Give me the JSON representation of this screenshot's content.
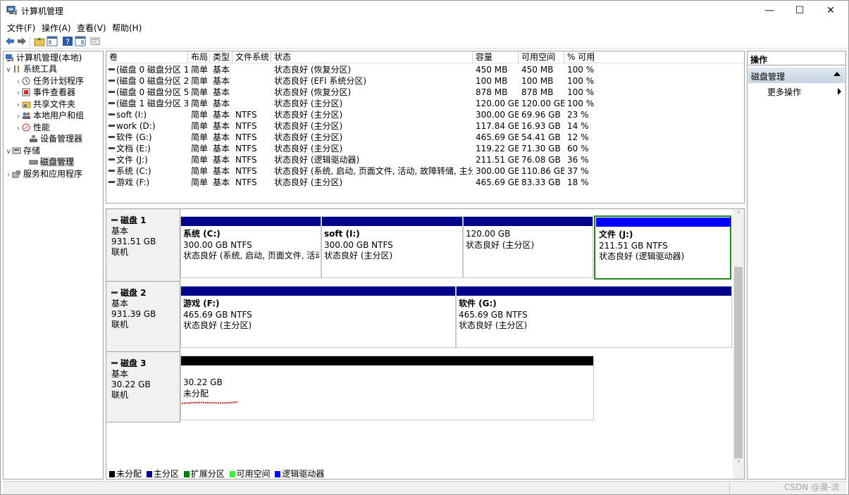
{
  "window": {
    "title": "计算机管理",
    "min_glyph": "—",
    "max_glyph": "☐",
    "close_glyph": "✕"
  },
  "menu": [
    "文件(F)",
    "操作(A)",
    "查看(V)",
    "帮助(H)"
  ],
  "toolbar_icons": [
    "back-arrow-icon",
    "forward-arrow-icon",
    "up-folder-icon",
    "show-hide-tree-icon",
    "help-icon",
    "properties-icon",
    "console-icon"
  ],
  "tree": {
    "root": "计算机管理(本地)",
    "system_tools": "系统工具",
    "task_scheduler": "任务计划程序",
    "event_viewer": "事件查看器",
    "shared_folders": "共享文件夹",
    "local_users": "本地用户和组",
    "performance": "性能",
    "device_manager": "设备管理器",
    "storage": "存储",
    "disk_management": "磁盘管理",
    "services": "服务和应用程序",
    "chev_open": "∨",
    "chev_closed": "›"
  },
  "columns": [
    "卷",
    "布局",
    "类型",
    "文件系统",
    "状态",
    "容量",
    "可用空间",
    "% 可用"
  ],
  "volumes": [
    {
      "name": "(磁盘 0 磁盘分区 1)",
      "layout": "简单",
      "type": "基本",
      "fs": "",
      "status": "状态良好 (恢复分区)",
      "capacity": "450 MB",
      "free": "450 MB",
      "pct": "100 %"
    },
    {
      "name": "(磁盘 0 磁盘分区 2)",
      "layout": "简单",
      "type": "基本",
      "fs": "",
      "status": "状态良好 (EFI 系统分区)",
      "capacity": "100 MB",
      "free": "100 MB",
      "pct": "100 %"
    },
    {
      "name": "(磁盘 0 磁盘分区 5)",
      "layout": "简单",
      "type": "基本",
      "fs": "",
      "status": "状态良好 (恢复分区)",
      "capacity": "878 MB",
      "free": "878 MB",
      "pct": "100 %"
    },
    {
      "name": "(磁盘 1 磁盘分区 3)",
      "layout": "简单",
      "type": "基本",
      "fs": "",
      "status": "状态良好 (主分区)",
      "capacity": "120.00 GB",
      "free": "120.00 GB",
      "pct": "100 %"
    },
    {
      "name": "soft (I:)",
      "layout": "简单",
      "type": "基本",
      "fs": "NTFS",
      "status": "状态良好 (主分区)",
      "capacity": "300.00 GB",
      "free": "69.96 GB",
      "pct": "23 %"
    },
    {
      "name": "work (D:)",
      "layout": "简单",
      "type": "基本",
      "fs": "NTFS",
      "status": "状态良好 (主分区)",
      "capacity": "117.84 GB",
      "free": "16.93 GB",
      "pct": "14 %"
    },
    {
      "name": "软件 (G:)",
      "layout": "简单",
      "type": "基本",
      "fs": "NTFS",
      "status": "状态良好 (主分区)",
      "capacity": "465.69 GB",
      "free": "54.41 GB",
      "pct": "12 %"
    },
    {
      "name": "文档 (E:)",
      "layout": "简单",
      "type": "基本",
      "fs": "NTFS",
      "status": "状态良好 (主分区)",
      "capacity": "119.22 GB",
      "free": "71.30 GB",
      "pct": "60 %"
    },
    {
      "name": "文件 (J:)",
      "layout": "简单",
      "type": "基本",
      "fs": "NTFS",
      "status": "状态良好 (逻辑驱动器)",
      "capacity": "211.51 GB",
      "free": "76.08 GB",
      "pct": "36 %"
    },
    {
      "name": "系统 (C:)",
      "layout": "简单",
      "type": "基本",
      "fs": "NTFS",
      "status": "状态良好 (系统, 启动, 页面文件, 活动, 故障转储, 主分区)",
      "capacity": "300.00 GB",
      "free": "110.86 GB",
      "pct": "37 %"
    },
    {
      "name": "游戏 (F:)",
      "layout": "简单",
      "type": "基本",
      "fs": "NTFS",
      "status": "状态良好 (主分区)",
      "capacity": "465.69 GB",
      "free": "83.33 GB",
      "pct": "18 %"
    }
  ],
  "disks": [
    {
      "name": "磁盘 1",
      "kind": "基本",
      "size": "931.51 GB",
      "state": "联机",
      "partitions": [
        {
          "name": "系统  (C:)",
          "size": "300.00 GB NTFS",
          "status": "状态良好 (系统, 启动, 页面文件, 活动,",
          "bar_color": "#00008b"
        },
        {
          "name": "soft  (I:)",
          "size": "300.00 GB NTFS",
          "status": "状态良好 (主分区)",
          "bar_color": "#00008b"
        },
        {
          "name": "",
          "size": "120.00 GB",
          "status": "状态良好 (主分区)",
          "bar_color": "#00008b"
        },
        {
          "name": "文件  (J:)",
          "size": "211.51 GB NTFS",
          "status": "状态良好 (逻辑驱动器)",
          "bar_color": "#0000ff",
          "selected": true
        }
      ]
    },
    {
      "name": "磁盘 2",
      "kind": "基本",
      "size": "931.39 GB",
      "state": "联机",
      "partitions": [
        {
          "name": "游戏  (F:)",
          "size": "465.69 GB NTFS",
          "status": "状态良好 (主分区)",
          "bar_color": "#00008b"
        },
        {
          "name": "软件  (G:)",
          "size": "465.69 GB NTFS",
          "status": "状态良好 (主分区)",
          "bar_color": "#00008b"
        }
      ]
    },
    {
      "name": "磁盘 3",
      "kind": "基本",
      "size": "30.22 GB",
      "state": "联机",
      "partitions": [
        {
          "name": "",
          "size": "30.22 GB",
          "status": "未分配",
          "bar_color": "#000000"
        }
      ]
    }
  ],
  "legend": [
    {
      "label": "未分配",
      "color": "#000000"
    },
    {
      "label": "主分区",
      "color": "#00008b"
    },
    {
      "label": "扩展分区",
      "color": "#008000"
    },
    {
      "label": "可用空间",
      "color": "#33ff33"
    },
    {
      "label": "逻辑驱动器",
      "color": "#0000ff"
    }
  ],
  "actions": {
    "title": "操作",
    "section": "磁盘管理",
    "more": "更多操作"
  },
  "scroll": {
    "up": "˄",
    "down": "˅"
  },
  "watermark": "CSDN @漫-流"
}
